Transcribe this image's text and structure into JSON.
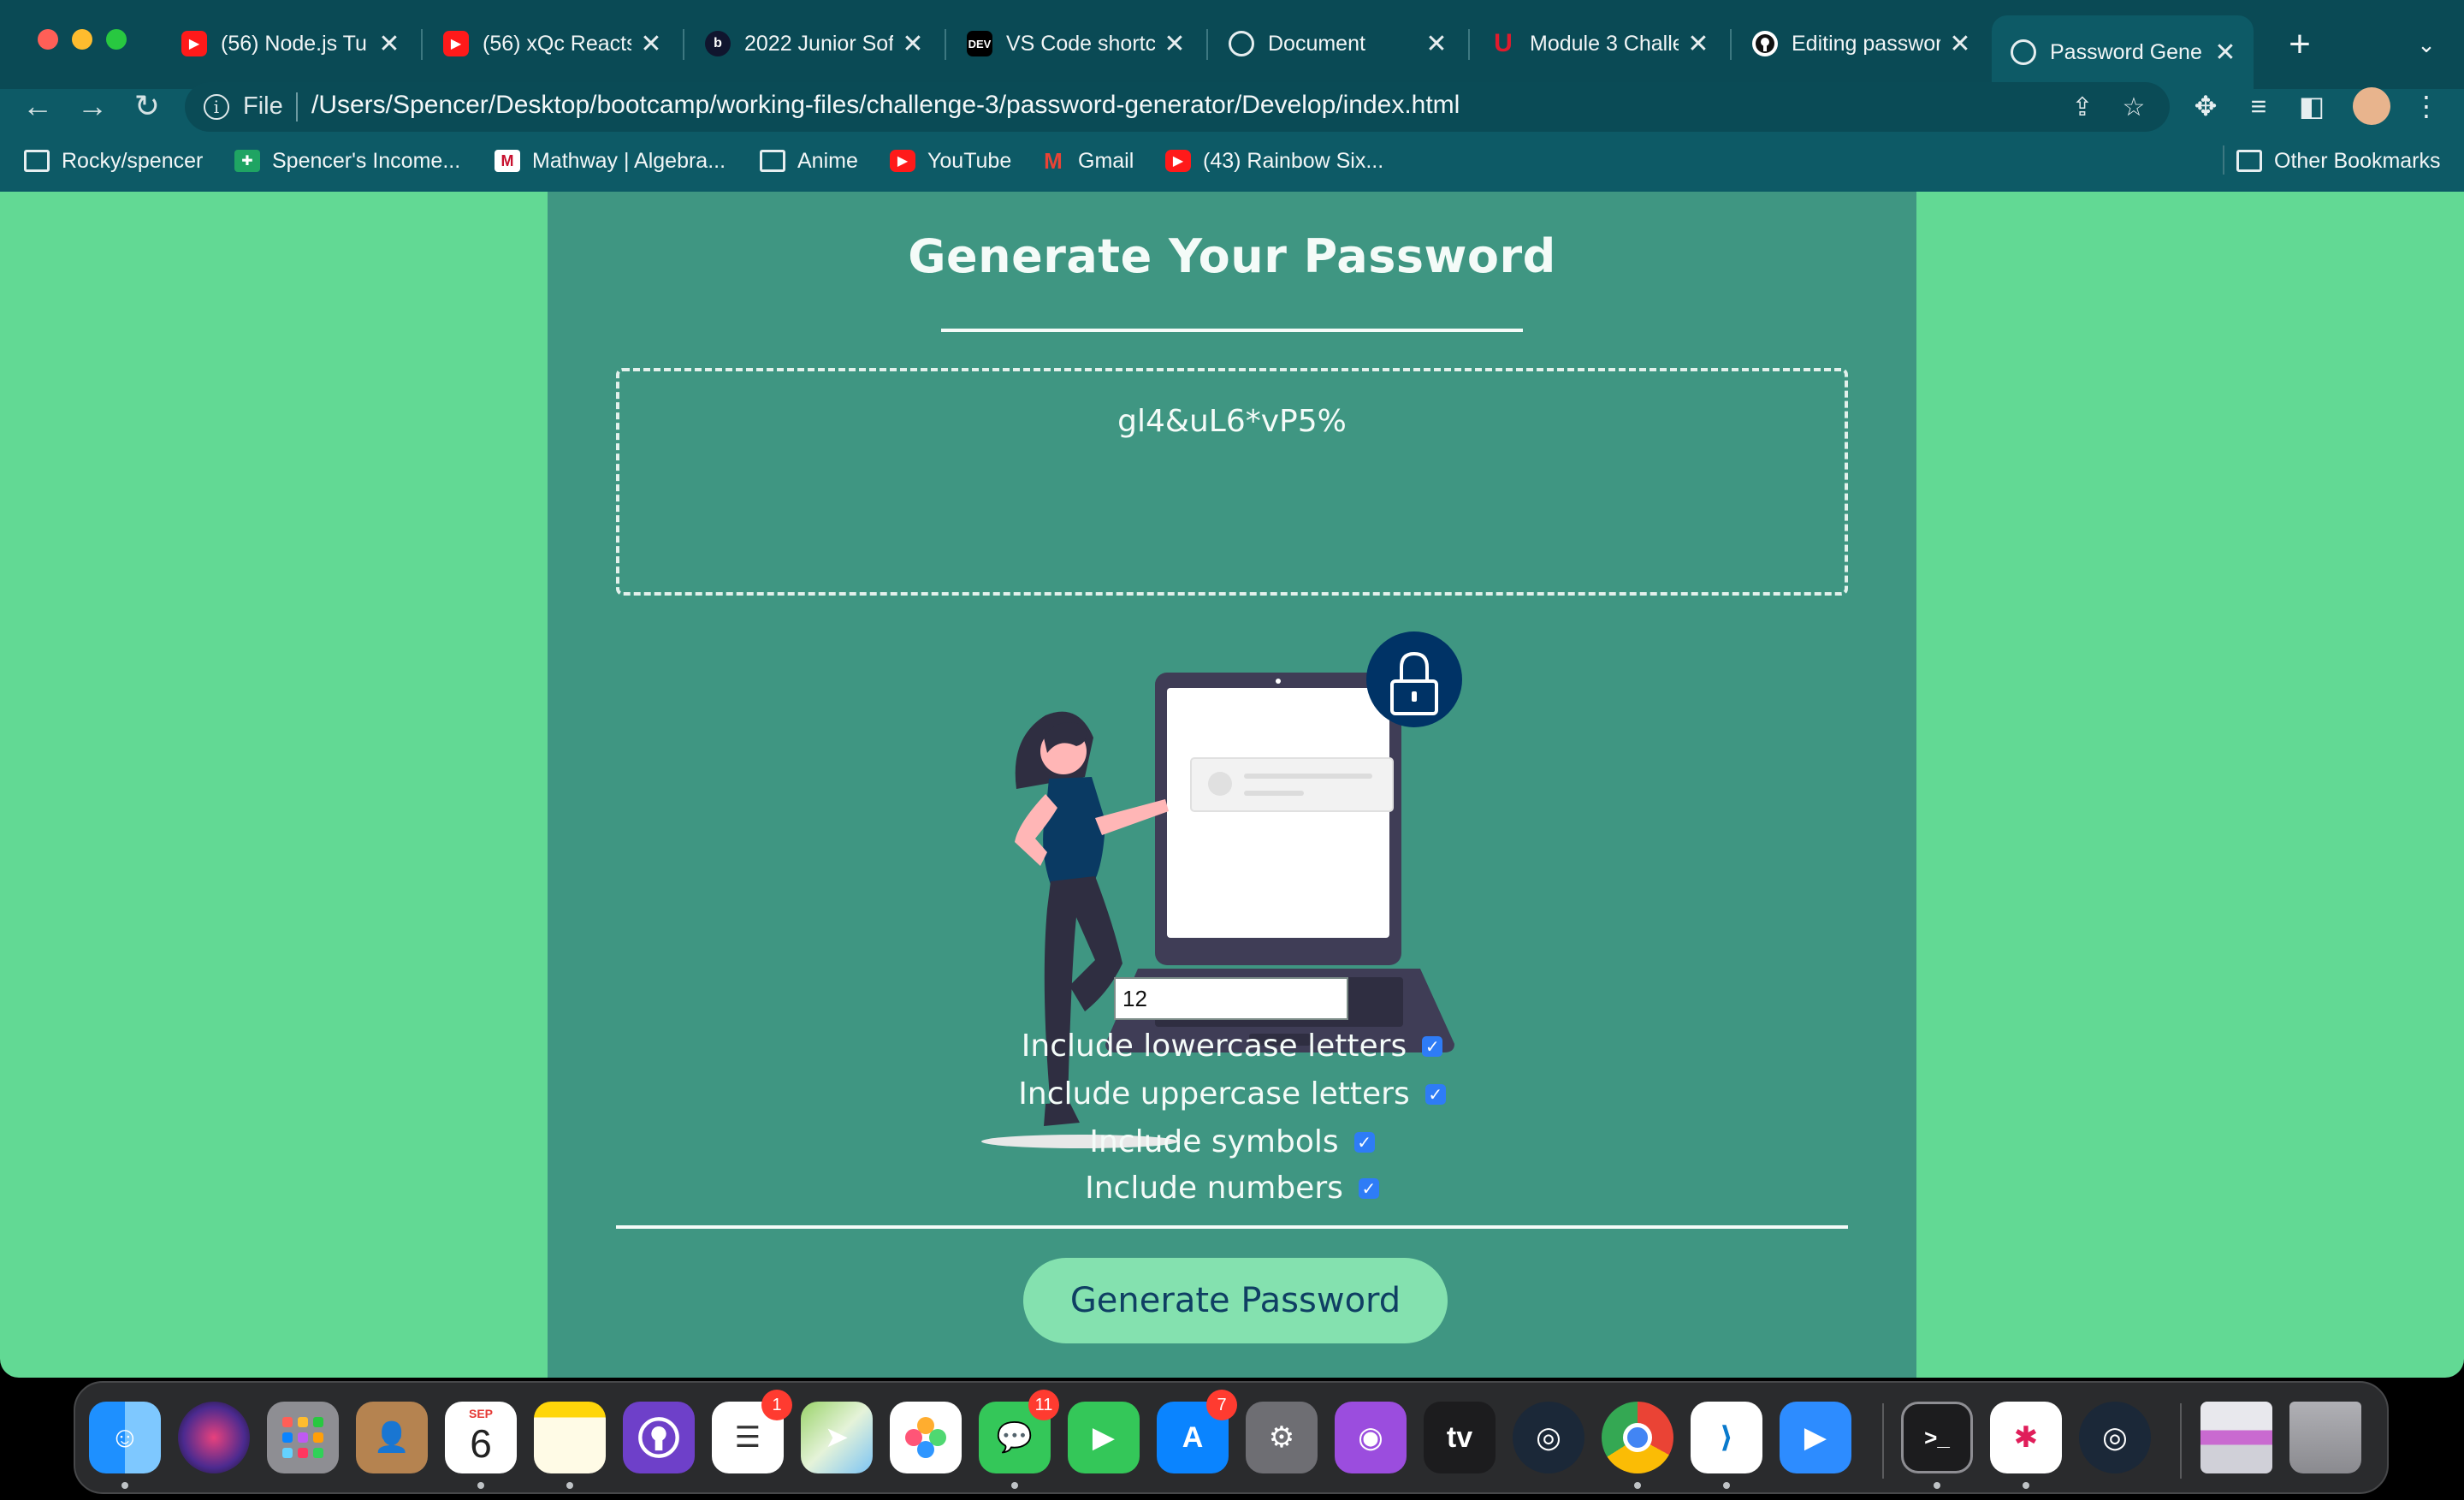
{
  "browser": {
    "tabs": [
      {
        "title": "(56) Node.js Tu",
        "favicon": "youtube-icon"
      },
      {
        "title": "(56) xQc Reacts",
        "favicon": "youtube-icon"
      },
      {
        "title": "2022 Junior Sof",
        "favicon": "b-icon"
      },
      {
        "title": "VS Code shortc",
        "favicon": "dev-icon"
      },
      {
        "title": "Document",
        "favicon": "globe-icon"
      },
      {
        "title": "Module 3 Challe",
        "favicon": "utah-icon"
      },
      {
        "title": "Editing passwor",
        "favicon": "github-icon"
      },
      {
        "title": "Password Gene",
        "favicon": "globe-icon",
        "active": true
      }
    ],
    "close_glyph": "✕",
    "new_tab_glyph": "+",
    "tab_menu_glyph": "⌄",
    "dev_label": "DEV",
    "b_label": "b",
    "u_label": "U",
    "address": {
      "scheme_label": "File",
      "url": "/Users/Spencer/Desktop/bootcamp/working-files/challenge-3/password-generator/Develop/index.html"
    },
    "bookmarks": [
      {
        "label": "Rocky/spencer",
        "icon": "folder-icon"
      },
      {
        "label": "Spencer's Income...",
        "icon": "sheets-icon"
      },
      {
        "label": "Mathway | Algebra...",
        "icon": "mathway-icon"
      },
      {
        "label": "Anime",
        "icon": "folder-icon"
      },
      {
        "label": "YouTube",
        "icon": "youtube-icon"
      },
      {
        "label": "Gmail",
        "icon": "gmail-icon"
      },
      {
        "label": "(43) Rainbow Six...",
        "icon": "youtube-icon"
      }
    ],
    "other_bookmarks": "Other Bookmarks",
    "mathway_label": "M",
    "gmail_label": "M"
  },
  "page": {
    "title": "Generate Your Password",
    "password": "gl4&uL6*vP5%",
    "length_value": "12",
    "options": [
      {
        "label": "Include lowercase letters",
        "checked": true
      },
      {
        "label": "Include uppercase letters",
        "checked": true
      },
      {
        "label": "Include symbols",
        "checked": true
      },
      {
        "label": "Include numbers",
        "checked": true
      }
    ],
    "checkmark": "✓",
    "generate_button": "Generate Password"
  },
  "colors": {
    "page_background": "#62d994",
    "card_background": "#3f9682",
    "button_background": "#84e1af",
    "button_text": "#0f3f63",
    "browser_chrome": "#0d5a66"
  },
  "dock": {
    "apps": [
      {
        "name": "finder-icon"
      },
      {
        "name": "siri-icon"
      },
      {
        "name": "launchpad-icon"
      },
      {
        "name": "contacts-icon"
      },
      {
        "name": "calendar-icon",
        "month": "SEP",
        "day": "6"
      },
      {
        "name": "notes-icon"
      },
      {
        "name": "github-desktop-icon"
      },
      {
        "name": "reminders-icon",
        "badge": "1"
      },
      {
        "name": "maps-icon"
      },
      {
        "name": "photos-icon"
      },
      {
        "name": "messages-icon",
        "badge": "11"
      },
      {
        "name": "facetime-icon"
      },
      {
        "name": "app-store-icon",
        "badge": "7"
      },
      {
        "name": "system-settings-icon"
      },
      {
        "name": "podcasts-icon"
      },
      {
        "name": "apple-tv-icon",
        "label": "tv"
      },
      {
        "name": "steam-icon"
      },
      {
        "name": "chrome-icon"
      },
      {
        "name": "vscode-icon"
      },
      {
        "name": "zoom-icon"
      },
      {
        "name": "terminal-icon",
        "label": ">_"
      },
      {
        "name": "slack-icon"
      },
      {
        "name": "steam-icon"
      },
      {
        "name": "printer-icon"
      },
      {
        "name": "trash-icon"
      }
    ]
  }
}
